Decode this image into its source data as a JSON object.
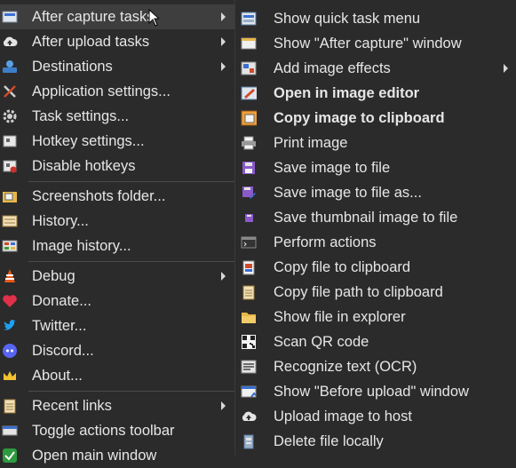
{
  "left_menu": {
    "items": [
      {
        "label": "After capture tasks",
        "has_submenu": true,
        "icon": "capture-icon"
      },
      {
        "label": "After upload tasks",
        "has_submenu": true,
        "icon": "cloud-upload-icon"
      },
      {
        "label": "Destinations",
        "has_submenu": true,
        "icon": "destinations-icon"
      },
      {
        "label": "Application settings...",
        "has_submenu": false,
        "icon": "tools-icon"
      },
      {
        "label": "Task settings...",
        "has_submenu": false,
        "icon": "gear-icon"
      },
      {
        "label": "Hotkey settings...",
        "has_submenu": false,
        "icon": "keyboard-icon"
      },
      {
        "label": "Disable hotkeys",
        "has_submenu": false,
        "icon": "keyboard-disabled-icon"
      },
      {
        "label": "Screenshots folder...",
        "has_submenu": false,
        "icon": "folder-images-icon"
      },
      {
        "label": "History...",
        "has_submenu": false,
        "icon": "history-icon"
      },
      {
        "label": "Image history...",
        "has_submenu": false,
        "icon": "image-history-icon"
      },
      {
        "label": "Debug",
        "has_submenu": true,
        "icon": "cone-icon"
      },
      {
        "label": "Donate...",
        "has_submenu": false,
        "icon": "heart-icon"
      },
      {
        "label": "Twitter...",
        "has_submenu": false,
        "icon": "twitter-icon"
      },
      {
        "label": "Discord...",
        "has_submenu": false,
        "icon": "discord-icon"
      },
      {
        "label": "About...",
        "has_submenu": false,
        "icon": "crown-icon"
      },
      {
        "label": "Recent links",
        "has_submenu": true,
        "icon": "clipboard-list-icon"
      },
      {
        "label": "Toggle actions toolbar",
        "has_submenu": false,
        "icon": "toolbar-icon"
      },
      {
        "label": "Open main window",
        "has_submenu": false,
        "icon": "check-icon"
      }
    ]
  },
  "right_menu": {
    "items": [
      {
        "label": "Show quick task menu",
        "bold": false,
        "has_submenu": false,
        "icon": "quick-task-icon"
      },
      {
        "label": "Show \"After capture\" window",
        "bold": false,
        "has_submenu": false,
        "icon": "window-icon"
      },
      {
        "label": "Add image effects",
        "bold": false,
        "has_submenu": true,
        "icon": "image-effects-icon"
      },
      {
        "label": "Open in image editor",
        "bold": true,
        "has_submenu": false,
        "icon": "image-editor-icon"
      },
      {
        "label": "Copy image to clipboard",
        "bold": true,
        "has_submenu": false,
        "icon": "copy-image-icon"
      },
      {
        "label": "Print image",
        "bold": false,
        "has_submenu": false,
        "icon": "printer-icon"
      },
      {
        "label": "Save image to file",
        "bold": false,
        "has_submenu": false,
        "icon": "save-icon"
      },
      {
        "label": "Save image to file as...",
        "bold": false,
        "has_submenu": false,
        "icon": "save-as-icon"
      },
      {
        "label": "Save thumbnail image to file",
        "bold": false,
        "has_submenu": false,
        "icon": "save-thumbnail-icon"
      },
      {
        "label": "Perform actions",
        "bold": false,
        "has_submenu": false,
        "icon": "terminal-icon"
      },
      {
        "label": "Copy file to clipboard",
        "bold": false,
        "has_submenu": false,
        "icon": "copy-file-icon"
      },
      {
        "label": "Copy file path to clipboard",
        "bold": false,
        "has_submenu": false,
        "icon": "copy-path-icon"
      },
      {
        "label": "Show file in explorer",
        "bold": false,
        "has_submenu": false,
        "icon": "folder-icon"
      },
      {
        "label": "Scan QR code",
        "bold": false,
        "has_submenu": false,
        "icon": "qr-code-icon"
      },
      {
        "label": "Recognize text (OCR)",
        "bold": false,
        "has_submenu": false,
        "icon": "ocr-icon"
      },
      {
        "label": "Show \"Before upload\" window",
        "bold": false,
        "has_submenu": false,
        "icon": "before-upload-icon"
      },
      {
        "label": "Upload image to host",
        "bold": false,
        "has_submenu": false,
        "icon": "cloud-upload-icon"
      },
      {
        "label": "Delete file locally",
        "bold": false,
        "has_submenu": false,
        "icon": "delete-file-icon"
      }
    ]
  },
  "colors": {
    "background": "#2b2b2b",
    "highlight": "#3e3e3e",
    "text": "#e6e6e6",
    "separator": "#4a4a4a"
  }
}
